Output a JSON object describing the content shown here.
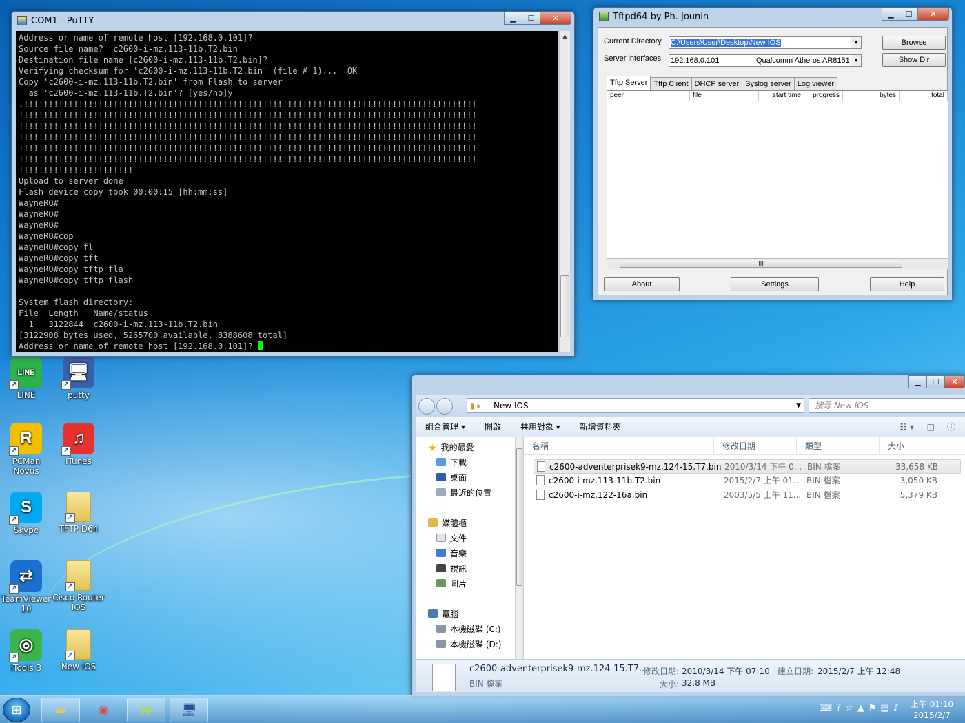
{
  "putty": {
    "title": "COM1 - PuTTY",
    "terminal_lines": [
      "Address or name of remote host [192.168.0.101]?",
      "Source file name?  c2600-i-mz.113-11b.T2.bin",
      "Destination file name [c2600-i-mz.113-11b.T2.bin]?",
      "Verifying checksum for 'c2600-i-mz.113-11b.T2.bin' (file # 1)...  OK",
      "Copy 'c2600-i-mz.113-11b.T2.bin' from Flash to server",
      "  as 'c2600-i-mz.113-11b.T2.bin'? [yes/no]y",
      ".!!!!!!!!!!!!!!!!!!!!!!!!!!!!!!!!!!!!!!!!!!!!!!!!!!!!!!!!!!!!!!!!!!!!!!!!!!!!!!!!!!!!!!!!!!!",
      "!!!!!!!!!!!!!!!!!!!!!!!!!!!!!!!!!!!!!!!!!!!!!!!!!!!!!!!!!!!!!!!!!!!!!!!!!!!!!!!!!!!!!!!!!!!!",
      "!!!!!!!!!!!!!!!!!!!!!!!!!!!!!!!!!!!!!!!!!!!!!!!!!!!!!!!!!!!!!!!!!!!!!!!!!!!!!!!!!!!!!!!!!!!!",
      "!!!!!!!!!!!!!!!!!!!!!!!!!!!!!!!!!!!!!!!!!!!!!!!!!!!!!!!!!!!!!!!!!!!!!!!!!!!!!!!!!!!!!!!!!!!!",
      "!!!!!!!!!!!!!!!!!!!!!!!!!!!!!!!!!!!!!!!!!!!!!!!!!!!!!!!!!!!!!!!!!!!!!!!!!!!!!!!!!!!!!!!!!!!!",
      "!!!!!!!!!!!!!!!!!!!!!!!!!!!!!!!!!!!!!!!!!!!!!!!!!!!!!!!!!!!!!!!!!!!!!!!!!!!!!!!!!!!!!!!!!!!!",
      "!!!!!!!!!!!!!!!!!!!!!!!",
      "Upload to server done",
      "Flash device copy took 00:00:15 [hh:mm:ss]",
      "WayneRO#",
      "WayneRO#",
      "WayneRO#",
      "WayneRO#cop",
      "WayneRO#copy fl",
      "WayneRO#copy tft",
      "WayneRO#copy tftp fla",
      "WayneRO#copy tftp flash",
      "",
      "System flash directory:",
      "File  Length   Name/status",
      "  1   3122844  c2600-i-mz.113-11b.T2.bin",
      "[3122908 bytes used, 5265700 available, 8388608 total]",
      "Address or name of remote host [192.168.0.101]? "
    ]
  },
  "tftpd": {
    "title": "Tftpd64 by Ph. Jounin",
    "current_directory_label": "Current Directory",
    "current_directory_value": "C:\\Users\\User\\Desktop\\New IOS",
    "server_interfaces_label": "Server interfaces",
    "server_interface_ip": "192.168.0.101",
    "server_interface_name": "Qualcomm Atheros AR8151 I",
    "browse": "Browse",
    "show_dir": "Show Dir",
    "tabs": [
      "Tftp Server",
      "Tftp Client",
      "DHCP server",
      "Syslog server",
      "Log viewer"
    ],
    "columns": [
      "peer",
      "file",
      "start time",
      "progress",
      "bytes",
      "total"
    ],
    "about": "About",
    "settings": "Settings",
    "help": "Help"
  },
  "explorer": {
    "address": "New IOS",
    "search_placeholder": "搜尋 New IOS",
    "toolbar": [
      "組合管理 ▾",
      "開啟",
      "共用對象 ▾",
      "新增資料夾"
    ],
    "nav": {
      "favorites": "我的最愛",
      "downloads": "下載",
      "desktop": "桌面",
      "recent": "最近的位置",
      "libraries": "媒體櫃",
      "documents": "文件",
      "music": "音樂",
      "video": "視訊",
      "pictures": "圖片",
      "computer": "電腦",
      "disk_c": "本機磁碟 (C:)",
      "disk_d": "本機磁碟 (D:)"
    },
    "columns": {
      "name": "名稱",
      "date": "修改日期",
      "type": "類型",
      "size": "大小"
    },
    "files": [
      {
        "name": "c2600-adventerprisek9-mz.124-15.T7.bin",
        "date": "2010/3/14 下午 0...",
        "type": "BIN 檔案",
        "size": "33,658 KB"
      },
      {
        "name": "c2600-i-mz.113-11b.T2.bin",
        "date": "2015/2/7 上午 01...",
        "type": "BIN 檔案",
        "size": "3,050 KB"
      },
      {
        "name": "c2600-i-mz.122-16a.bin",
        "date": "2003/5/5 上午 11...",
        "type": "BIN 檔案",
        "size": "5,379 KB"
      }
    ],
    "status": {
      "file_name": "c2600-adventerprisek9-mz.124-15.T7....",
      "modified_label": "修改日期:",
      "modified_value": "2010/3/14 下午 07:10",
      "created_label": "建立日期:",
      "created_value": "2015/2/7 上午 12:48",
      "type": "BIN 檔案",
      "size_label": "大小:",
      "size_value": "32.8 MB"
    }
  },
  "desktop_icons": [
    {
      "label": "LINE",
      "short": "LINE",
      "color": "#2bb24c"
    },
    {
      "label": "putty",
      "short": "🖥",
      "color": "#3b5fa8"
    },
    {
      "label": "PCMan Novus",
      "short": "R",
      "color": "#f2c000"
    },
    {
      "label": "iTunes",
      "short": "♫",
      "color": "#e5322d"
    },
    {
      "label": "Skype",
      "short": "S",
      "color": "#00a9f0"
    },
    {
      "label": "TFTP D64",
      "short": "",
      "color": "#e8c85a"
    },
    {
      "label": "TeamViewer 10",
      "short": "⇄",
      "color": "#1b6fd1"
    },
    {
      "label": "Cisco Router IOS",
      "short": "",
      "color": "#e8c85a"
    },
    {
      "label": "iTools 3",
      "short": "◎",
      "color": "#3ab54a"
    },
    {
      "label": "New IOS",
      "short": "",
      "color": "#e8c85a"
    }
  ],
  "taskbar": {
    "time": "上午 01:10",
    "date": "2015/2/7"
  }
}
